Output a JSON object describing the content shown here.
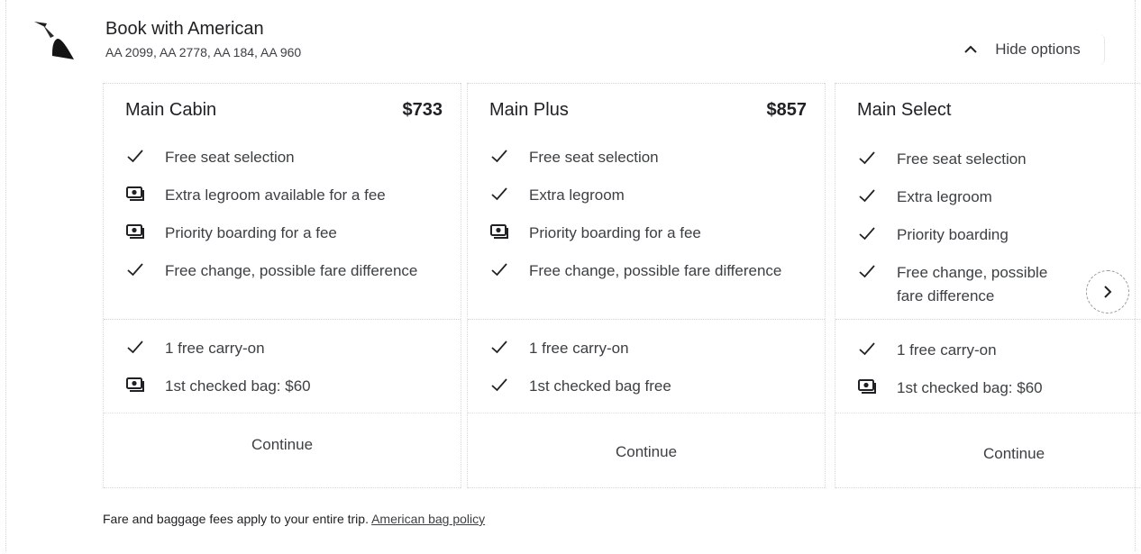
{
  "header": {
    "title": "Book with American",
    "flights": "AA 2099, AA 2778, AA 184, AA 960",
    "hide_options_label": "Hide options"
  },
  "cards": [
    {
      "name": "Main Cabin",
      "price": "$733",
      "features": [
        {
          "icon": "check-icon",
          "text": "Free seat selection"
        },
        {
          "icon": "money-icon",
          "text": "Extra legroom available for a fee"
        },
        {
          "icon": "money-icon",
          "text": "Priority boarding for a fee"
        },
        {
          "icon": "check-icon",
          "text": "Free change, possible fare difference"
        }
      ],
      "bags": [
        {
          "icon": "check-icon",
          "text": "1 free carry-on"
        },
        {
          "icon": "money-icon",
          "text": "1st checked bag: $60"
        }
      ],
      "continue_label": "Continue"
    },
    {
      "name": "Main Plus",
      "price": "$857",
      "features": [
        {
          "icon": "check-icon",
          "text": "Free seat selection"
        },
        {
          "icon": "check-icon",
          "text": "Extra legroom"
        },
        {
          "icon": "money-icon",
          "text": "Priority boarding for a fee"
        },
        {
          "icon": "check-icon",
          "text": "Free change, possible fare difference"
        }
      ],
      "bags": [
        {
          "icon": "check-icon",
          "text": "1 free carry-on"
        },
        {
          "icon": "check-icon",
          "text": "1st checked bag free"
        }
      ],
      "continue_label": "Continue"
    },
    {
      "name": "Main Select",
      "price": "",
      "features": [
        {
          "icon": "check-icon",
          "text": "Free seat selection"
        },
        {
          "icon": "check-icon",
          "text": "Extra legroom"
        },
        {
          "icon": "check-icon",
          "text": "Priority boarding"
        },
        {
          "icon": "check-icon",
          "text": "Free change, possible fare difference"
        }
      ],
      "bags": [
        {
          "icon": "check-icon",
          "text": "1 free carry-on"
        },
        {
          "icon": "money-icon",
          "text": "1st checked bag: $60"
        }
      ],
      "continue_label": "Continue"
    }
  ],
  "footer": {
    "text": "Fare and baggage fees apply to your entire trip.",
    "link_label": "American bag policy"
  }
}
